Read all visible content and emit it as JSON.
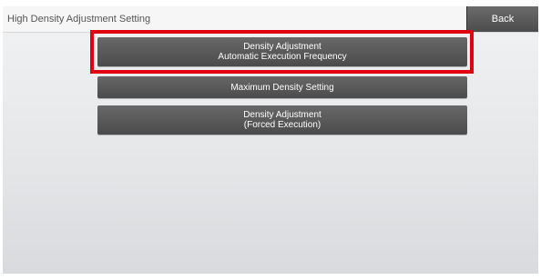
{
  "header": {
    "title": "High Density Adjustment Setting",
    "back_label": "Back"
  },
  "menu": [
    {
      "line1": "Density Adjustment",
      "line2": "Automatic Execution Frequency",
      "highlighted": true
    },
    {
      "line1": "Maximum Density Setting",
      "line2": "",
      "highlighted": false
    },
    {
      "line1": "Density Adjustment",
      "line2": "(Forced Execution)",
      "highlighted": false
    }
  ],
  "colors": {
    "highlight": "#e00010",
    "button": "#555555"
  }
}
